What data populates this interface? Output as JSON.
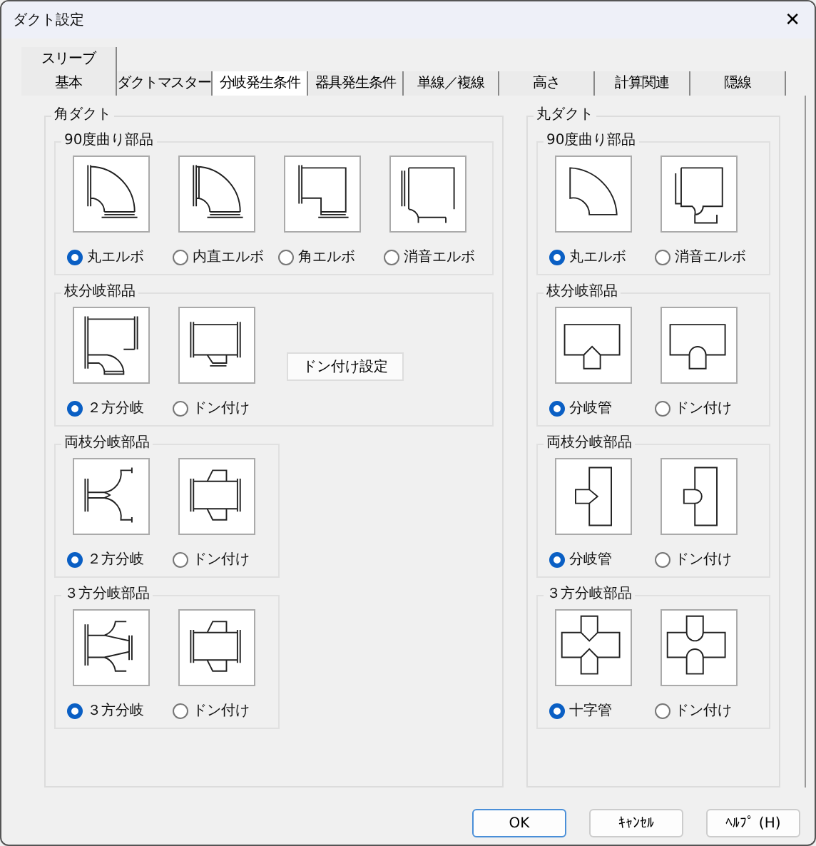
{
  "window": {
    "title": "ダクト設定",
    "close": "✕"
  },
  "tab_rows": [
    [
      {
        "label": "スリーブ",
        "selected": false
      }
    ],
    [
      {
        "label": "基本",
        "selected": false
      },
      {
        "label": "ダクトマスター",
        "selected": false
      },
      {
        "label": "分岐発生条件",
        "selected": true
      },
      {
        "label": "器具発生条件",
        "selected": false
      },
      {
        "label": "単線／複線",
        "selected": false
      },
      {
        "label": "高さ",
        "selected": false
      },
      {
        "label": "計算関連",
        "selected": false
      },
      {
        "label": "隠線",
        "selected": false
      }
    ]
  ],
  "panels": [
    {
      "title": "角ダクト",
      "groups": [
        {
          "title": "90度曲り部品",
          "options": [
            {
              "label": "丸エルボ",
              "selected": true,
              "kind": "elbow"
            },
            {
              "label": "内直エルボ",
              "selected": false,
              "kind": "straightelbow"
            },
            {
              "label": "角エルボ",
              "selected": false,
              "kind": "squareelbow"
            },
            {
              "label": "消音エルボ",
              "selected": false,
              "kind": "silencerelbow"
            }
          ]
        },
        {
          "title": "枝分岐部品",
          "button": "ドン付け設定",
          "options": [
            {
              "label": "２方分岐",
              "selected": true,
              "kind": "branch"
            },
            {
              "label": "ドン付け",
              "selected": false,
              "kind": "tap"
            }
          ]
        },
        {
          "title": "両枝分岐部品",
          "options": [
            {
              "label": "２方分岐",
              "selected": true,
              "kind": "dualbranch"
            },
            {
              "label": "ドン付け",
              "selected": false,
              "kind": "dualtap"
            }
          ]
        },
        {
          "title": "３方分岐部品",
          "options": [
            {
              "label": "３方分岐",
              "selected": true,
              "kind": "triplebranch"
            },
            {
              "label": "ドン付け",
              "selected": false,
              "kind": "dualtap"
            }
          ]
        }
      ]
    },
    {
      "title": "丸ダクト",
      "groups": [
        {
          "title": "90度曲り部品",
          "options": [
            {
              "label": "丸エルボ",
              "selected": true,
              "kind": "pipeelbow"
            },
            {
              "label": "消音エルボ",
              "selected": false,
              "kind": "pipesilencer"
            }
          ]
        },
        {
          "title": "枝分岐部品",
          "options": [
            {
              "label": "分岐管",
              "selected": true,
              "kind": "pipebranch"
            },
            {
              "label": "ドン付け",
              "selected": false,
              "kind": "pipetap"
            }
          ]
        },
        {
          "title": "両枝分岐部品",
          "options": [
            {
              "label": "分岐管",
              "selected": true,
              "kind": "pipedual"
            },
            {
              "label": "ドン付け",
              "selected": false,
              "kind": "pipedualtap"
            }
          ]
        },
        {
          "title": "３方分岐部品",
          "options": [
            {
              "label": "十字管",
              "selected": true,
              "kind": "pipecross"
            },
            {
              "label": "ドン付け",
              "selected": false,
              "kind": "pipecrosstap"
            }
          ]
        }
      ]
    }
  ],
  "buttons": [
    {
      "label": "OK",
      "default": true
    },
    {
      "label": "ｷｬﾝｾﾙ",
      "default": false
    },
    {
      "label": "ﾍﾙﾌﾟ (H)",
      "default": false
    }
  ]
}
